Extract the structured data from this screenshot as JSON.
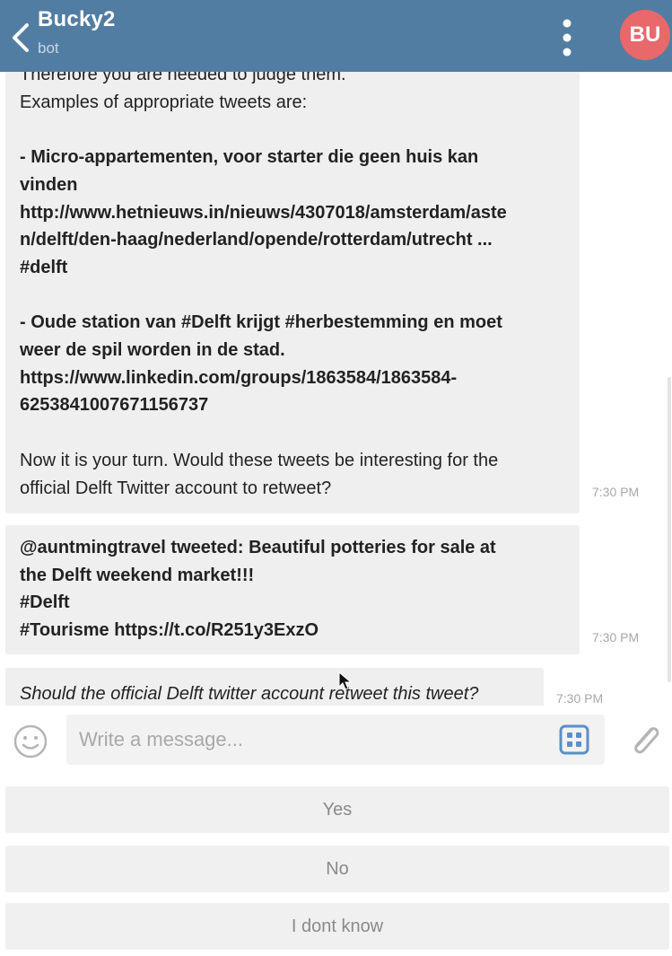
{
  "header": {
    "title": "Bucky2",
    "subtitle": "bot",
    "avatar_initials": "BU",
    "color": "#527da3",
    "avatar_color": "#e8686b",
    "back_icon": "chevron-left-icon",
    "menu_icon": "vertical-dots-icon"
  },
  "messages": [
    {
      "lines": [
        {
          "text": "Therefore you are needed to judge them.",
          "bold": false
        },
        {
          "text": "Examples of appropriate tweets are:",
          "bold": false
        },
        {
          "text": "",
          "bold": false
        },
        {
          "text": "- Micro-appartementen, voor starter die geen huis kan",
          "bold": true
        },
        {
          "text": "vinden",
          "bold": true
        },
        {
          "text": "http://www.hetnieuws.in/nieuws/4307018/amsterdam/aste",
          "bold": true
        },
        {
          "text": "n/delft/den-haag/nederland/opende/rotterdam/utrecht ...",
          "bold": true
        },
        {
          "text": "#delft",
          "bold": true
        },
        {
          "text": "",
          "bold": false
        },
        {
          "text": "- Oude station van #Delft krijgt #herbestemming en moet",
          "bold": true
        },
        {
          "text": "weer de spil worden in de stad.",
          "bold": true
        },
        {
          "text": "https://www.linkedin.com/groups/1863584/1863584-",
          "bold": true
        },
        {
          "text": "6253841007671156737",
          "bold": true
        },
        {
          "text": "",
          "bold": false
        },
        {
          "text": "Now it is your turn. Would these tweets be interesting for the",
          "bold": false
        },
        {
          "text": "official Delft Twitter account to retweet?",
          "bold": false
        }
      ],
      "time": "7:30 PM"
    },
    {
      "lines": [
        {
          "text": "@auntmingtravel tweeted: Beautiful potteries for sale at",
          "bold": true
        },
        {
          "text": "the Delft weekend market!!!",
          "bold": true
        },
        {
          "text": "#Delft",
          "bold": true
        },
        {
          "text": "#Tourisme https://t.co/R251y3ExzO",
          "bold": true
        }
      ],
      "time": "7:30 PM"
    },
    {
      "lines": [
        {
          "text": "Should the official Delft twitter account retweet this tweet?",
          "bold": false
        }
      ],
      "time": "7:30 PM"
    }
  ],
  "composer": {
    "placeholder": "Write a message...",
    "emoji_icon": "smiley-icon",
    "keyboard_icon": "keyboard-grid-icon",
    "attach_icon": "paperclip-icon"
  },
  "reply_keyboard": {
    "buttons": [
      "Yes",
      "No",
      "I dont know"
    ]
  }
}
